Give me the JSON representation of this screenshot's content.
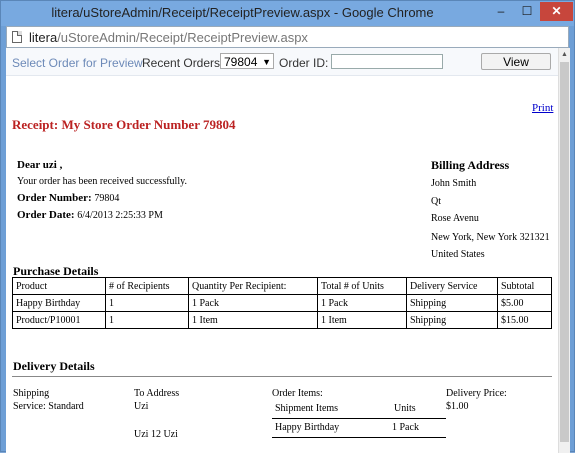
{
  "window": {
    "title": "litera/uStoreAdmin/Receipt/ReceiptPreview.aspx - Google Chrome",
    "url_host": "litera",
    "url_path": "/uStoreAdmin/Receipt/ReceiptPreview.aspx",
    "min": "–",
    "max": "☐",
    "close": "✕"
  },
  "toolbar": {
    "select_order_link": "Select Order for Preview",
    "recent_orders_label": "Recent Orders:",
    "recent_orders_value": "79804",
    "order_id_label": "Order ID:",
    "order_id_value": "",
    "view_button": "View"
  },
  "receipt": {
    "print_link": "Print",
    "title": "Receipt: My Store Order Number 79804",
    "greeting": "Dear uzi ,",
    "message": "Your order has been received successfully.",
    "order_number_label": "Order Number:",
    "order_number": "79804",
    "order_date_label": "Order Date:",
    "order_date": "6/4/2013 2:25:33 PM"
  },
  "billing": {
    "heading": "Billing Address",
    "lines": [
      "John Smith",
      "Qt",
      "Rose Avenu",
      "New York, New York 321321",
      "United States"
    ]
  },
  "purchase": {
    "heading": "Purchase Details",
    "columns": [
      "Product",
      "# of Recipients",
      "Quantity Per Recipient:",
      "Total # of Units",
      "Delivery Service",
      "Subtotal"
    ],
    "rows": [
      [
        "Happy Birthday",
        "1",
        "1 Pack",
        "1 Pack",
        "Shipping",
        "$5.00"
      ],
      [
        "Product/P10001",
        "1",
        "1 Item",
        "1 Item",
        "Shipping",
        "$15.00"
      ]
    ]
  },
  "delivery": {
    "heading": "Delivery Details",
    "shipping_label": "Shipping",
    "shipping_service": "Service: Standard",
    "to_address_label": "To Address",
    "to_address_name": "Uzi",
    "to_address_line": "Uzi 12 Uzi",
    "order_items_label": "Order Items:",
    "items_col1": "Shipment Items",
    "items_col2": "Units",
    "items": [
      [
        "Happy Birthday",
        "1 Pack"
      ]
    ],
    "price_label": "Delivery Price:",
    "price": "$1.00"
  }
}
